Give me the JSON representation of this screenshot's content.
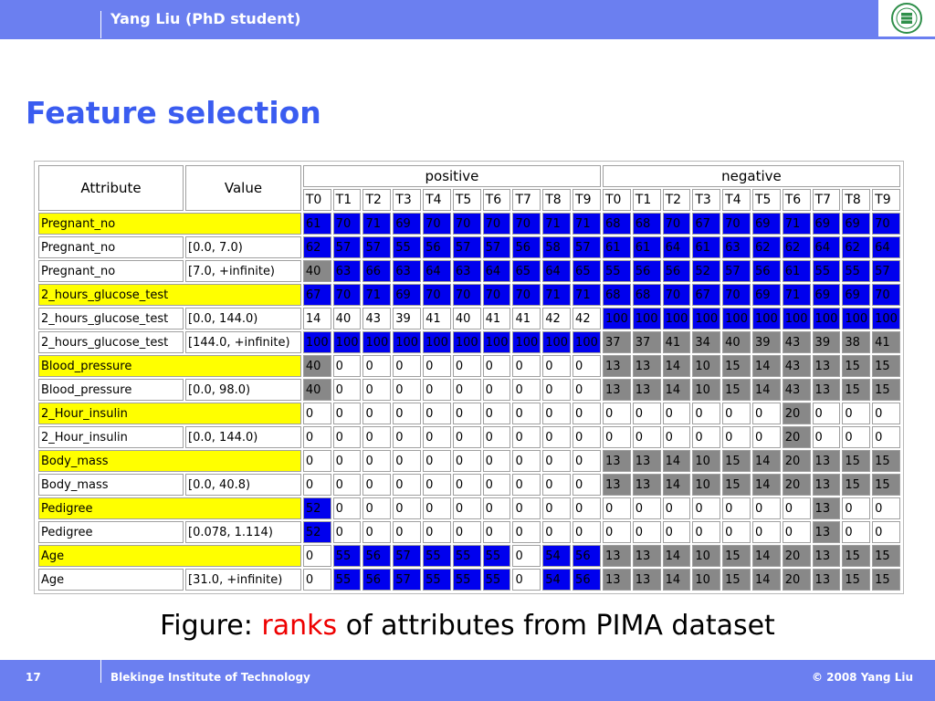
{
  "header": {
    "author": "Yang Liu (PhD student)"
  },
  "title": "Feature selection",
  "table": {
    "col_attribute": "Attribute",
    "col_value": "Value",
    "group_positive": "positive",
    "group_negative": "negative",
    "t_labels": [
      "T0",
      "T1",
      "T2",
      "T3",
      "T4",
      "T5",
      "T6",
      "T7",
      "T8",
      "T9"
    ],
    "rows": [
      {
        "attr": "Pregnant_no",
        "value": "",
        "yellow": true,
        "pos": [
          "61",
          "70",
          "71",
          "69",
          "70",
          "70",
          "70",
          "70",
          "71",
          "71"
        ],
        "pos_c": "BBBBBBBBBB",
        "neg": [
          "68",
          "68",
          "70",
          "67",
          "70",
          "69",
          "71",
          "69",
          "69",
          "70"
        ],
        "neg_c": "BBBBBBBBBB"
      },
      {
        "attr": "Pregnant_no",
        "value": "[0.0, 7.0)",
        "yellow": false,
        "pos": [
          "62",
          "57",
          "57",
          "55",
          "56",
          "57",
          "57",
          "56",
          "58",
          "57"
        ],
        "pos_c": "BBBBBBBBBB",
        "neg": [
          "61",
          "61",
          "64",
          "61",
          "63",
          "62",
          "62",
          "64",
          "62",
          "64"
        ],
        "neg_c": "BBBBBBBBBB"
      },
      {
        "attr": "Pregnant_no",
        "value": "[7.0, +infinite)",
        "yellow": false,
        "pos": [
          "40",
          "63",
          "66",
          "63",
          "64",
          "63",
          "64",
          "65",
          "64",
          "65"
        ],
        "pos_c": "GBBBBBBBBB",
        "neg": [
          "55",
          "56",
          "56",
          "52",
          "57",
          "56",
          "61",
          "55",
          "55",
          "57"
        ],
        "neg_c": "BBBBBBBBBB"
      },
      {
        "attr": "2_hours_glucose_test",
        "value": "",
        "yellow": true,
        "pos": [
          "67",
          "70",
          "71",
          "69",
          "70",
          "70",
          "70",
          "70",
          "71",
          "71"
        ],
        "pos_c": "BBBBBBBBBB",
        "neg": [
          "68",
          "68",
          "70",
          "67",
          "70",
          "69",
          "71",
          "69",
          "69",
          "70"
        ],
        "neg_c": "BBBBBBBBBB"
      },
      {
        "attr": "2_hours_glucose_test",
        "value": "[0.0, 144.0)",
        "yellow": false,
        "pos": [
          "14",
          "40",
          "43",
          "39",
          "41",
          "40",
          "41",
          "41",
          "42",
          "42"
        ],
        "pos_c": "WWWWWWWWWW",
        "neg": [
          "100",
          "100",
          "100",
          "100",
          "100",
          "100",
          "100",
          "100",
          "100",
          "100"
        ],
        "neg_c": "BBBBBBBBBB"
      },
      {
        "attr": "2_hours_glucose_test",
        "value": "[144.0, +infinite)",
        "yellow": false,
        "pos": [
          "100",
          "100",
          "100",
          "100",
          "100",
          "100",
          "100",
          "100",
          "100",
          "100"
        ],
        "pos_c": "BBBBBBBBBB",
        "neg": [
          "37",
          "37",
          "41",
          "34",
          "40",
          "39",
          "43",
          "39",
          "38",
          "41"
        ],
        "neg_c": "GGGGGGGGGG"
      },
      {
        "attr": "Blood_pressure",
        "value": "",
        "yellow": true,
        "pos": [
          "40",
          "0",
          "0",
          "0",
          "0",
          "0",
          "0",
          "0",
          "0",
          "0"
        ],
        "pos_c": "GWWWWWWWWW",
        "neg": [
          "13",
          "13",
          "14",
          "10",
          "15",
          "14",
          "43",
          "13",
          "15",
          "15"
        ],
        "neg_c": "GGGGGGGGGG"
      },
      {
        "attr": "Blood_pressure",
        "value": "[0.0, 98.0)",
        "yellow": false,
        "pos": [
          "40",
          "0",
          "0",
          "0",
          "0",
          "0",
          "0",
          "0",
          "0",
          "0"
        ],
        "pos_c": "GWWWWWWWWW",
        "neg": [
          "13",
          "13",
          "14",
          "10",
          "15",
          "14",
          "43",
          "13",
          "15",
          "15"
        ],
        "neg_c": "GGGGGGGGGG"
      },
      {
        "attr": "2_Hour_insulin",
        "value": "",
        "yellow": true,
        "pos": [
          "0",
          "0",
          "0",
          "0",
          "0",
          "0",
          "0",
          "0",
          "0",
          "0"
        ],
        "pos_c": "WWWWWWWWWW",
        "neg": [
          "0",
          "0",
          "0",
          "0",
          "0",
          "0",
          "20",
          "0",
          "0",
          "0"
        ],
        "neg_c": "WWWWWWGWWW"
      },
      {
        "attr": "2_Hour_insulin",
        "value": "[0.0, 144.0)",
        "yellow": false,
        "pos": [
          "0",
          "0",
          "0",
          "0",
          "0",
          "0",
          "0",
          "0",
          "0",
          "0"
        ],
        "pos_c": "WWWWWWWWWW",
        "neg": [
          "0",
          "0",
          "0",
          "0",
          "0",
          "0",
          "20",
          "0",
          "0",
          "0"
        ],
        "neg_c": "WWWWWWGWWW"
      },
      {
        "attr": "Body_mass",
        "value": "",
        "yellow": true,
        "pos": [
          "0",
          "0",
          "0",
          "0",
          "0",
          "0",
          "0",
          "0",
          "0",
          "0"
        ],
        "pos_c": "WWWWWWWWWW",
        "neg": [
          "13",
          "13",
          "14",
          "10",
          "15",
          "14",
          "20",
          "13",
          "15",
          "15"
        ],
        "neg_c": "GGGGGGGGGG"
      },
      {
        "attr": "Body_mass",
        "value": "[0.0, 40.8)",
        "yellow": false,
        "pos": [
          "0",
          "0",
          "0",
          "0",
          "0",
          "0",
          "0",
          "0",
          "0",
          "0"
        ],
        "pos_c": "WWWWWWWWWW",
        "neg": [
          "13",
          "13",
          "14",
          "10",
          "15",
          "14",
          "20",
          "13",
          "15",
          "15"
        ],
        "neg_c": "GGGGGGGGGG"
      },
      {
        "attr": "Pedigree",
        "value": "",
        "yellow": true,
        "pos": [
          "52",
          "0",
          "0",
          "0",
          "0",
          "0",
          "0",
          "0",
          "0",
          "0"
        ],
        "pos_c": "BWWWWWWWWW",
        "neg": [
          "0",
          "0",
          "0",
          "0",
          "0",
          "0",
          "0",
          "13",
          "0",
          "0"
        ],
        "neg_c": "WWWWWWWGWW"
      },
      {
        "attr": "Pedigree",
        "value": "[0.078, 1.114)",
        "yellow": false,
        "pos": [
          "52",
          "0",
          "0",
          "0",
          "0",
          "0",
          "0",
          "0",
          "0",
          "0"
        ],
        "pos_c": "BWWWWWWWWW",
        "neg": [
          "0",
          "0",
          "0",
          "0",
          "0",
          "0",
          "0",
          "13",
          "0",
          "0"
        ],
        "neg_c": "WWWWWWWGWW"
      },
      {
        "attr": "Age",
        "value": "",
        "yellow": true,
        "pos": [
          "0",
          "55",
          "56",
          "57",
          "55",
          "55",
          "55",
          "0",
          "54",
          "56"
        ],
        "pos_c": "WBBBBBBWBB",
        "neg": [
          "13",
          "13",
          "14",
          "10",
          "15",
          "14",
          "20",
          "13",
          "15",
          "15"
        ],
        "neg_c": "GGGGGGGGGG"
      },
      {
        "attr": "Age",
        "value": "[31.0, +infinite)",
        "yellow": false,
        "pos": [
          "0",
          "55",
          "56",
          "57",
          "55",
          "55",
          "55",
          "0",
          "54",
          "56"
        ],
        "pos_c": "WBBBBBBWBB",
        "neg": [
          "13",
          "13",
          "14",
          "10",
          "15",
          "14",
          "20",
          "13",
          "15",
          "15"
        ],
        "neg_c": "GGGGGGGGGG"
      }
    ]
  },
  "caption": {
    "pre": "Figure: ",
    "em": "ranks",
    "post": " of attributes from PIMA dataset"
  },
  "footer": {
    "page_number": "17",
    "institution": "Blekinge Institute of Technology",
    "copyright": "© 2008 Yang Liu"
  },
  "colors": {
    "bar": "#6b7ff0",
    "title": "#3a5cf0",
    "yellow": "#ffff00",
    "blue": "#0000ee",
    "gray": "#888888",
    "emphasis": "#ee0000"
  }
}
